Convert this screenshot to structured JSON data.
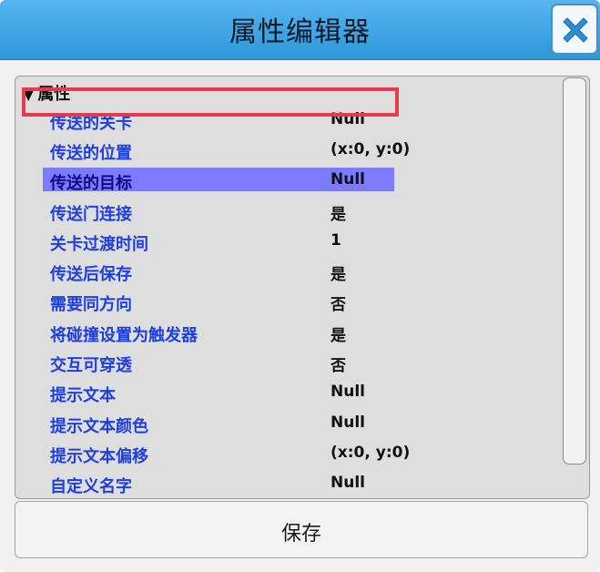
{
  "window": {
    "title": "属性编辑器"
  },
  "titlebar": {
    "close_icon": "close-icon"
  },
  "properties": {
    "group_label": "属性",
    "items": [
      {
        "key": "传送的关卡",
        "value": "Null"
      },
      {
        "key": "传送的位置",
        "value": "(x:0, y:0)"
      },
      {
        "key": "传送的目标",
        "value": "Null"
      },
      {
        "key": "传送门连接",
        "value": "是"
      },
      {
        "key": "关卡过渡时间",
        "value": "1"
      },
      {
        "key": "传送后保存",
        "value": "是"
      },
      {
        "key": "需要同方向",
        "value": "否"
      },
      {
        "key": "将碰撞设置为触发器",
        "value": "是"
      },
      {
        "key": "交互可穿透",
        "value": "否"
      },
      {
        "key": "提示文本",
        "value": "Null"
      },
      {
        "key": "提示文本颜色",
        "value": "Null"
      },
      {
        "key": "提示文本偏移",
        "value": "(x:0, y:0)"
      },
      {
        "key": "自定义名字",
        "value": "Null"
      }
    ],
    "selected_item": "传送的目标"
  },
  "footer": {
    "save_label": "保存"
  },
  "colors": {
    "titlebar": "#3aa6e6",
    "key_text": "#1e3ee0",
    "selection": "#7b7bfb",
    "highlight_border": "#e8394d"
  }
}
